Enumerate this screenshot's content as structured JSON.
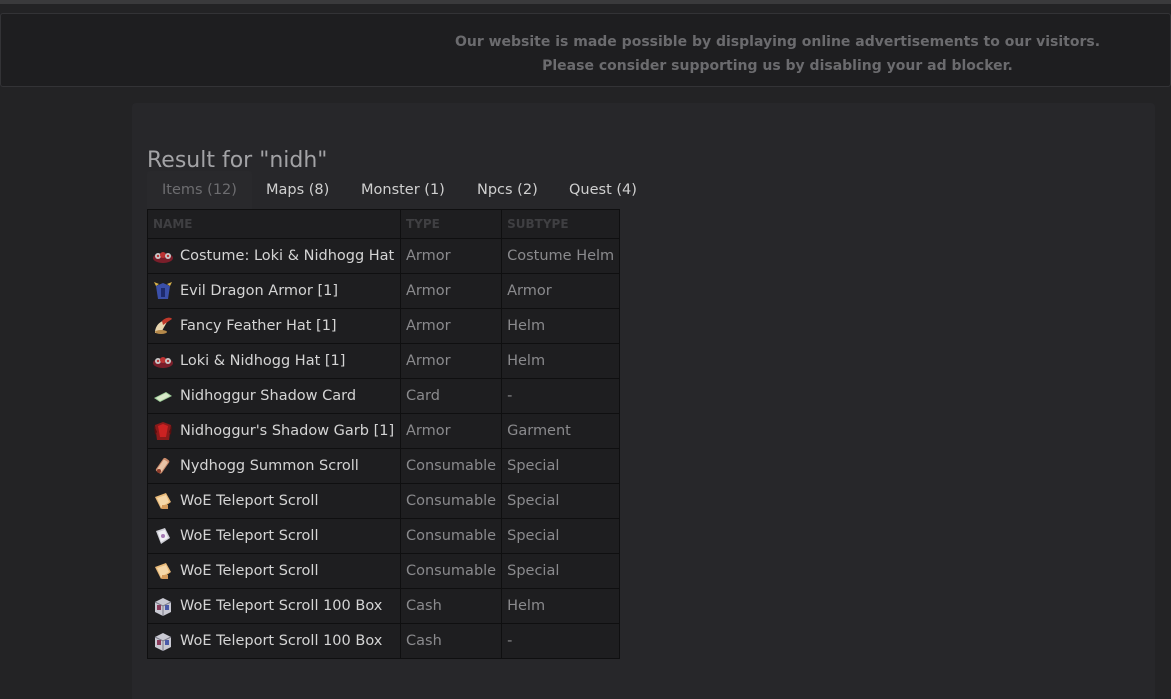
{
  "ad_notice": {
    "line1": "Our website is made possible by displaying online advertisements to our visitors.",
    "line2": "Please consider supporting us by disabling your ad blocker."
  },
  "page": {
    "title": "Result for \"nidh\""
  },
  "tabs": [
    {
      "label": "Items (12)",
      "active": true
    },
    {
      "label": "Maps (8)",
      "active": false
    },
    {
      "label": "Monster (1)",
      "active": false
    },
    {
      "label": "Npcs (2)",
      "active": false
    },
    {
      "label": "Quest (4)",
      "active": false
    }
  ],
  "table": {
    "headers": {
      "name": "NAME",
      "type": "TYPE",
      "subtype": "SUBTYPE"
    },
    "rows": [
      {
        "icon": "loki-hat-icon",
        "name": "Costume: Loki & Nidhogg Hat",
        "type": "Armor",
        "subtype": "Costume Helm"
      },
      {
        "icon": "dragon-armor-icon",
        "name": "Evil Dragon Armor [1]",
        "type": "Armor",
        "subtype": "Armor"
      },
      {
        "icon": "feather-hat-icon",
        "name": "Fancy Feather Hat [1]",
        "type": "Armor",
        "subtype": "Helm"
      },
      {
        "icon": "loki-hat-icon",
        "name": "Loki & Nidhogg Hat [1]",
        "type": "Armor",
        "subtype": "Helm"
      },
      {
        "icon": "card-icon",
        "name": "Nidhoggur Shadow Card",
        "type": "Card",
        "subtype": "-"
      },
      {
        "icon": "shadow-garb-icon",
        "name": "Nidhoggur's Shadow Garb [1]",
        "type": "Armor",
        "subtype": "Garment"
      },
      {
        "icon": "summon-scroll-icon",
        "name": "Nydhogg Summon Scroll",
        "type": "Consumable",
        "subtype": "Special"
      },
      {
        "icon": "scroll-icon",
        "name": "WoE Teleport Scroll",
        "type": "Consumable",
        "subtype": "Special"
      },
      {
        "icon": "scroll-white-icon",
        "name": "WoE Teleport Scroll",
        "type": "Consumable",
        "subtype": "Special"
      },
      {
        "icon": "scroll-icon",
        "name": "WoE Teleport Scroll",
        "type": "Consumable",
        "subtype": "Special"
      },
      {
        "icon": "box-icon",
        "name": "WoE Teleport Scroll 100 Box",
        "type": "Cash",
        "subtype": "Helm"
      },
      {
        "icon": "box-icon",
        "name": "WoE Teleport Scroll 100 Box",
        "type": "Cash",
        "subtype": "-"
      }
    ]
  }
}
